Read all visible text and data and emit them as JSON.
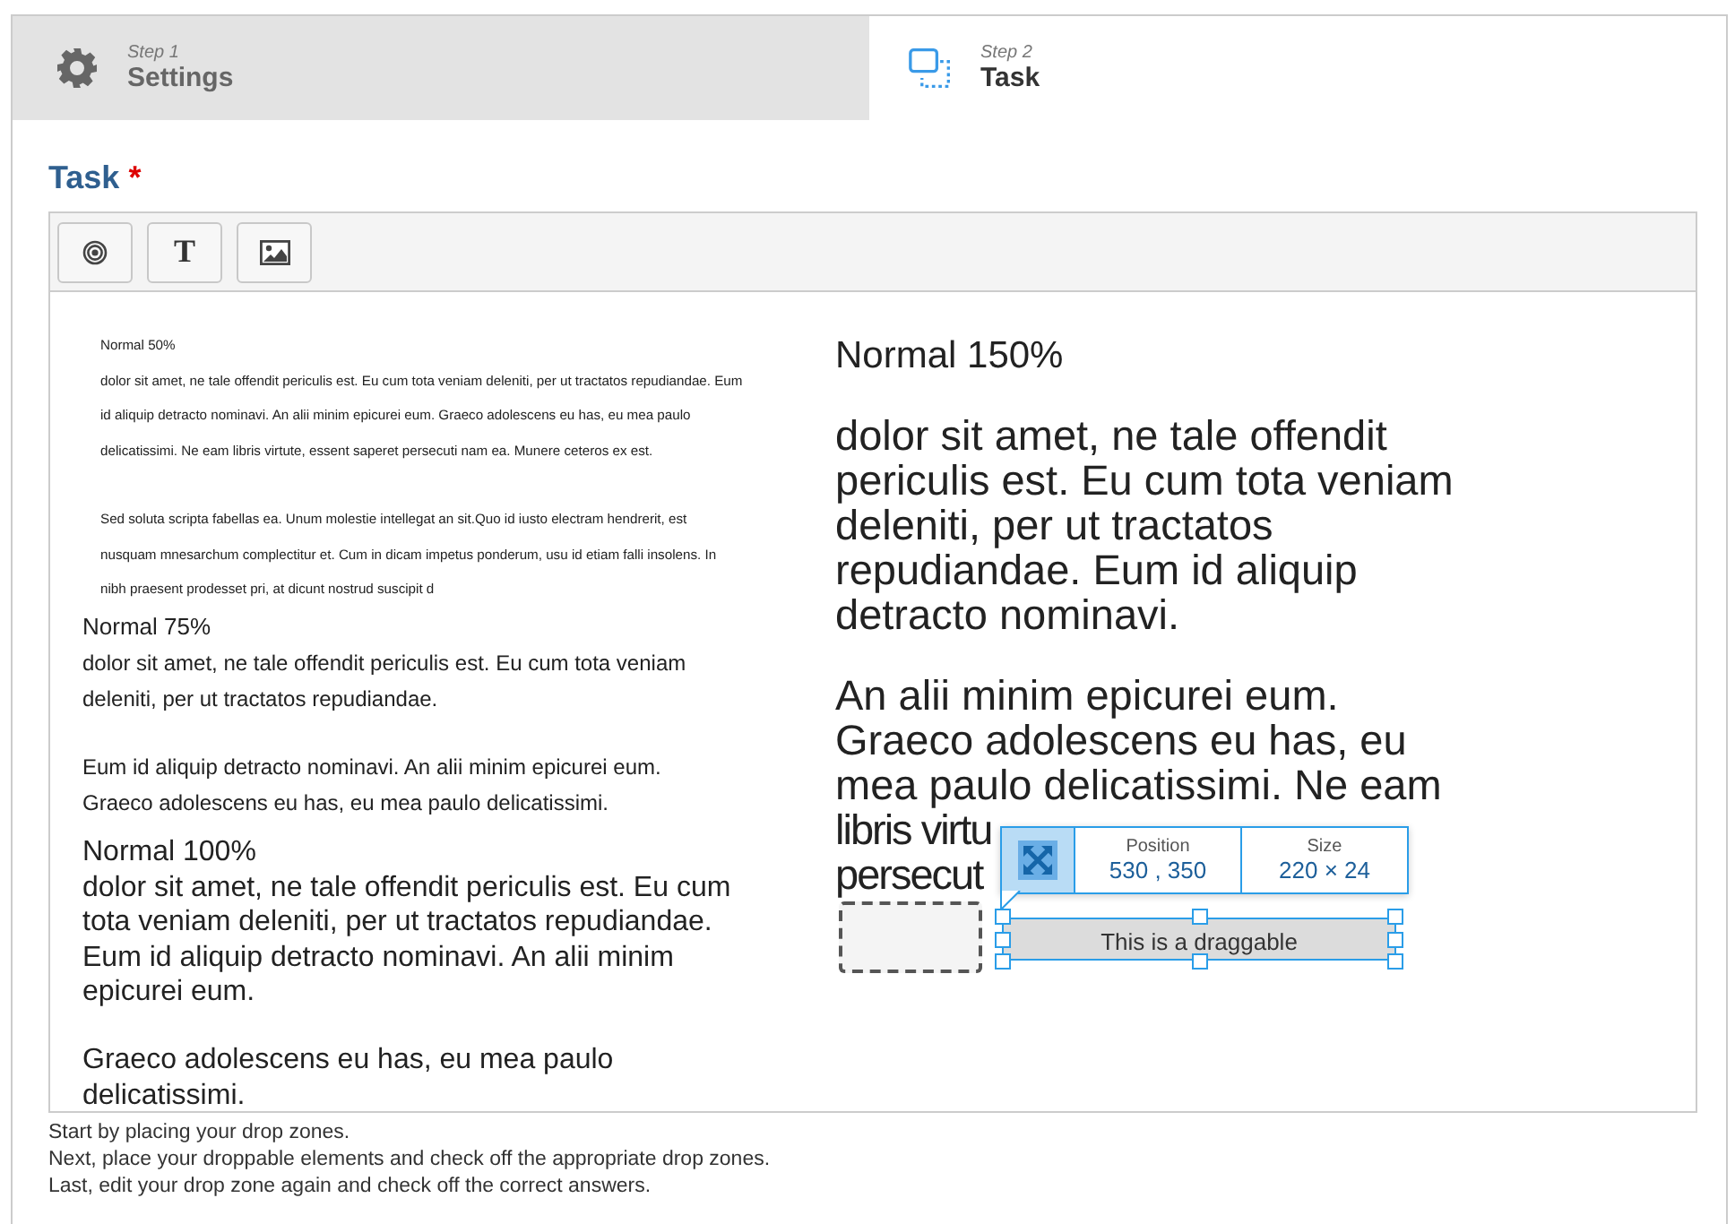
{
  "steps": [
    {
      "step": "Step 1",
      "label": "Settings",
      "kind": "gear",
      "selected": false
    },
    {
      "step": "Step 2",
      "label": "Task",
      "kind": "dropzone",
      "selected": true
    }
  ],
  "task": {
    "label": "Task",
    "required_mark": "*"
  },
  "toolbar": [
    {
      "kind": "target"
    },
    {
      "kind": "text",
      "label": "T"
    },
    {
      "kind": "image"
    }
  ],
  "canvas": {
    "elements": [
      {
        "kind": "text",
        "title": "Normal 50%",
        "paragraphs": [
          "dolor sit amet, ne tale offendit periculis est. Eu cum tota veniam deleniti, per ut tractatos repudiandae. Eum id aliquip detracto nominavi. An alii minim epicurei eum. Graeco adolescens eu has, eu mea paulo delicatissimi. Ne eam libris virtute, essent saperet persecuti nam ea. Munere ceteros ex est.",
          "Sed soluta scripta fabellas ea. Unum molestie intellegat an sit.Quo id iusto electram hendrerit, est nusquam mnesarchum complectitur et. Cum in dicam impetus ponderum, usu id etiam falli insolens. In nibh praesent prodesset pri, at dicunt nostrud suscipit d"
        ]
      },
      {
        "kind": "text",
        "title": "Normal 75%",
        "paragraphs": [
          "dolor sit amet, ne tale offendit periculis est. Eu cum tota veniam deleniti, per ut tractatos repudiandae.",
          "Eum id aliquip detracto nominavi. An alii minim epicurei eum. Graeco adolescens eu has, eu mea paulo delicatissimi."
        ]
      },
      {
        "kind": "text",
        "title": "Normal 100%",
        "paragraphs": [
          "dolor sit amet, ne tale offendit periculis est. Eu cum tota veniam deleniti, per ut tractatos repudiandae. Eum id aliquip detracto nominavi. An alii minim epicurei eum.",
          "Graeco adolescens eu has, eu mea paulo delicatissimi."
        ]
      },
      {
        "kind": "text",
        "title": "Normal 150%",
        "paragraphs": [
          "dolor sit amet, ne tale offendit periculis est. Eu cum tota veniam deleniti, per ut tractatos repudiandae. Eum id aliquip detracto nominavi.",
          "An alii minim epicurei eum. Graeco adolescens eu has, eu mea paulo delicatissimi. Ne eam",
          "libris virtu",
          "persecut"
        ]
      },
      {
        "kind": "dropzone"
      },
      {
        "kind": "draggable",
        "label": "This is a draggable",
        "selected": true
      }
    ],
    "popup": {
      "position_label": "Position",
      "position": "530 , 350",
      "size_label": "Size",
      "size": "220 × 24"
    }
  },
  "instructions": [
    "Start by placing your drop zones.",
    "Next, place your droppable elements and check off the appropriate drop zones.",
    "Last, edit your drop zone again and check off the correct answers."
  ]
}
